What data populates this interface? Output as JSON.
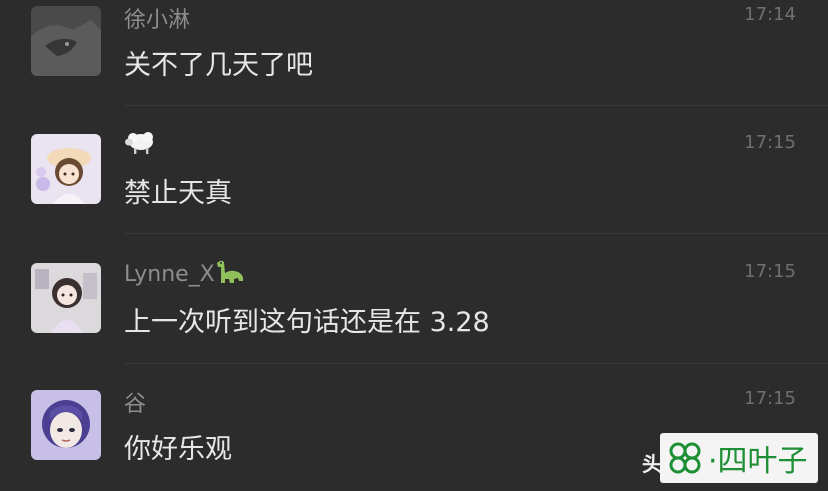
{
  "messages": [
    {
      "name": "徐小淋",
      "text": "关不了几天了吧",
      "time": "17:14"
    },
    {
      "name": "",
      "name_icon": "sheep-emoji-icon",
      "text": "禁止天真",
      "time": "17:15"
    },
    {
      "name": "Lynne_X",
      "name_icon": "dinosaur-emoji-icon",
      "text": "上一次听到这句话还是在 3.28",
      "time": "17:15"
    },
    {
      "name": "谷",
      "text": "你好乐观",
      "time": "17:15"
    }
  ],
  "watermark": {
    "partial_text": "头",
    "logo_icon": "four-leaf-clover-icon",
    "text": "·四叶子",
    "color": "#1e8f34"
  }
}
